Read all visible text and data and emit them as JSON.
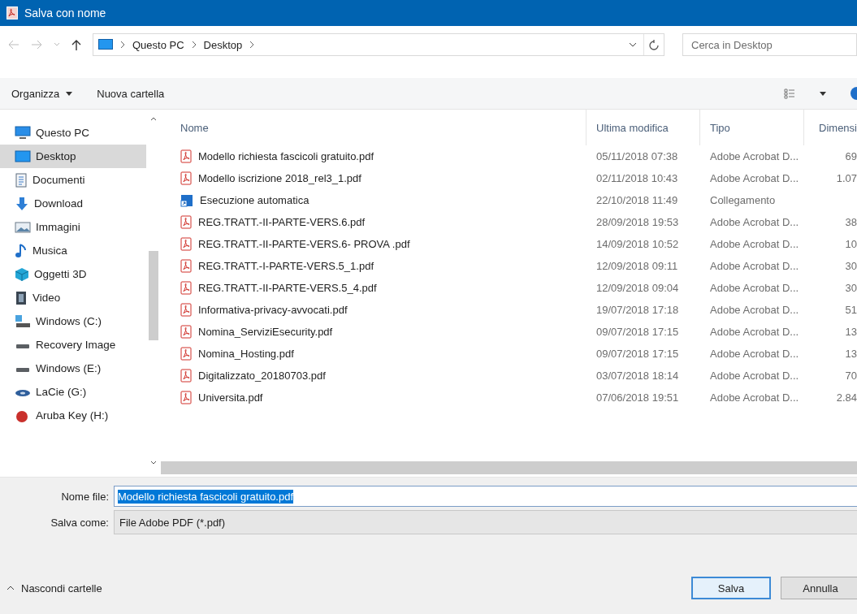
{
  "window": {
    "title": "Salva con nome"
  },
  "address_bar": {
    "breadcrumbs": [
      "Questo PC",
      "Desktop"
    ]
  },
  "search": {
    "placeholder": "Cerca in Desktop"
  },
  "toolbar": {
    "organize": "Organizza",
    "new_folder": "Nuova cartella"
  },
  "sidebar": {
    "items": [
      {
        "label": "Questo PC",
        "kind": "pc",
        "selected": false
      },
      {
        "label": "Desktop",
        "kind": "desktop",
        "selected": true
      },
      {
        "label": "Documenti",
        "kind": "documents",
        "selected": false
      },
      {
        "label": "Download",
        "kind": "download",
        "selected": false
      },
      {
        "label": "Immagini",
        "kind": "pictures",
        "selected": false
      },
      {
        "label": "Musica",
        "kind": "music",
        "selected": false
      },
      {
        "label": "Oggetti 3D",
        "kind": "objects3d",
        "selected": false
      },
      {
        "label": "Video",
        "kind": "video",
        "selected": false
      },
      {
        "label": "Windows (C:)",
        "kind": "system-drive",
        "selected": false
      },
      {
        "label": "Recovery Image",
        "kind": "drive",
        "selected": false
      },
      {
        "label": "Windows (E:)",
        "kind": "drive",
        "selected": false
      },
      {
        "label": "LaCie (G:)",
        "kind": "external-drive",
        "selected": false
      },
      {
        "label": "Aruba Key (H:)",
        "kind": "key",
        "selected": false
      }
    ]
  },
  "table": {
    "columns": [
      "Nome",
      "Ultima modifica",
      "Tipo",
      "Dimensi"
    ],
    "rows": [
      {
        "kind": "pdf",
        "name": "Modello richiesta fascicoli gratuito.pdf",
        "modified": "05/11/2018 07:38",
        "type": "Adobe Acrobat D...",
        "size": "69"
      },
      {
        "kind": "pdf",
        "name": "Modello iscrizione 2018_rel3_1.pdf",
        "modified": "02/11/2018 10:43",
        "type": "Adobe Acrobat D...",
        "size": "1.07"
      },
      {
        "kind": "shortcut",
        "name": "Esecuzione automatica",
        "modified": "22/10/2018 11:49",
        "type": "Collegamento"
      },
      {
        "kind": "pdf",
        "name": "REG.TRATT.-II-PARTE-VERS.6.pdf",
        "modified": "28/09/2018 19:53",
        "type": "Adobe Acrobat D...",
        "size": "38"
      },
      {
        "kind": "pdf",
        "name": "REG.TRATT.-II-PARTE-VERS.6- PROVA .pdf",
        "modified": "14/09/2018 10:52",
        "type": "Adobe Acrobat D...",
        "size": "10"
      },
      {
        "kind": "pdf",
        "name": "REG.TRATT.-I-PARTE-VERS.5_1.pdf",
        "modified": "12/09/2018 09:11",
        "type": "Adobe Acrobat D...",
        "size": "30"
      },
      {
        "kind": "pdf",
        "name": "REG.TRATT.-II-PARTE-VERS.5_4.pdf",
        "modified": "12/09/2018 09:04",
        "type": "Adobe Acrobat D...",
        "size": "30"
      },
      {
        "kind": "pdf",
        "name": "Informativa-privacy-avvocati.pdf",
        "modified": "19/07/2018 17:18",
        "type": "Adobe Acrobat D...",
        "size": "51"
      },
      {
        "kind": "pdf",
        "name": "Nomina_ServiziEsecurity.pdf",
        "modified": "09/07/2018 17:15",
        "type": "Adobe Acrobat D...",
        "size": "13"
      },
      {
        "kind": "pdf",
        "name": "Nomina_Hosting.pdf",
        "modified": "09/07/2018 17:15",
        "type": "Adobe Acrobat D...",
        "size": "13"
      },
      {
        "kind": "pdf",
        "name": "Digitalizzato_20180703.pdf",
        "modified": "03/07/2018 18:14",
        "type": "Adobe Acrobat D...",
        "size": "70"
      },
      {
        "kind": "pdf",
        "name": "Universita.pdf",
        "modified": "07/06/2018 19:51",
        "type": "Adobe Acrobat D...",
        "size": "2.84"
      }
    ]
  },
  "form": {
    "file_name_label": "Nome file:",
    "file_name": "Modello richiesta fascicoli gratuito.pdf",
    "save_as_label": "Salva come:",
    "save_as": "File Adobe PDF (*.pdf)"
  },
  "footer": {
    "hide_folders": "Nascondi cartelle",
    "buttons": [
      "Salva",
      "Annulla"
    ]
  }
}
